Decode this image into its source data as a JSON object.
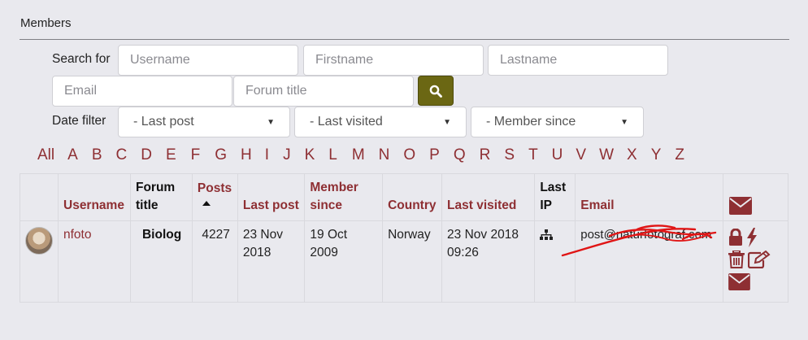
{
  "section": {
    "title": "Members"
  },
  "search": {
    "label": "Search for",
    "username_placeholder": "Username",
    "firstname_placeholder": "Firstname",
    "lastname_placeholder": "Lastname",
    "email_placeholder": "Email",
    "forum_title_placeholder": "Forum title"
  },
  "date_filter": {
    "label": "Date filter",
    "last_post": "- Last post",
    "last_visited": "- Last visited",
    "member_since": "- Member since"
  },
  "alphabet": [
    "All",
    "A",
    "B",
    "C",
    "D",
    "E",
    "F",
    "G",
    "H",
    "I",
    "J",
    "K",
    "L",
    "M",
    "N",
    "O",
    "P",
    "Q",
    "R",
    "S",
    "T",
    "U",
    "V",
    "W",
    "X",
    "Y",
    "Z"
  ],
  "table": {
    "headers": {
      "username": "Username",
      "forum_title_1": "Forum",
      "forum_title_2": "title",
      "posts": "Posts",
      "last_post": "Last post",
      "member_since_1": "Member",
      "member_since_2": "since",
      "country": "Country",
      "last_visited": "Last visited",
      "last_ip_1": "Last",
      "last_ip_2": "IP",
      "email": "Email"
    },
    "rows": [
      {
        "username": "nfoto",
        "forum_title": "Biolog",
        "posts": "4227",
        "last_post_1": "23 Nov",
        "last_post_2": "2018",
        "member_since_1": "19 Oct",
        "member_since_2": "2009",
        "country": "Norway",
        "last_visited_1": "23 Nov 2018",
        "last_visited_2": "09:26",
        "email": "post@naturfotograf.com"
      }
    ]
  },
  "colors": {
    "accent": "#8e2f33",
    "search_button": "#6b6713",
    "background": "#e9e9ee"
  },
  "icons": [
    "search-icon",
    "envelope-icon",
    "lock-icon",
    "bolt-icon",
    "trash-icon",
    "edit-icon",
    "sitemap-icon",
    "chevron-down-icon"
  ]
}
